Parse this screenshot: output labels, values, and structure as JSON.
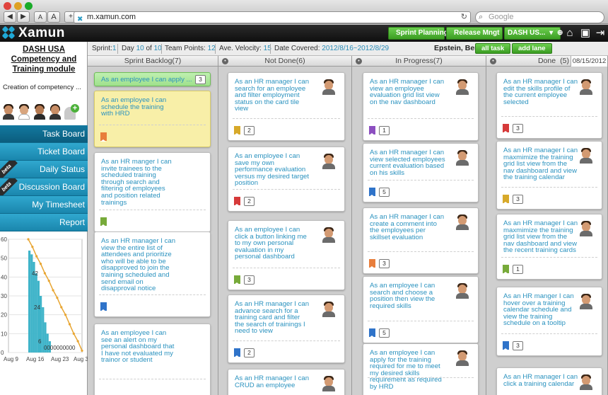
{
  "browser": {
    "back": "◀",
    "forward": "▶",
    "font_smaller": "A",
    "font_larger": "A",
    "add": "+",
    "url": "m.xamun.com",
    "search_placeholder": "Google"
  },
  "header": {
    "logo_text": "Xamun",
    "buttons": [
      "Sprint Planning",
      "Release Mngt",
      "DASH US..."
    ],
    "icons": [
      "home-icon",
      "screen-icon",
      "logout-icon"
    ]
  },
  "sprintbar": {
    "sprint_label": "Sprint:",
    "sprint_value": "1",
    "day_label": "Day",
    "day_value": "10",
    "day_of": "of",
    "day_total": "10",
    "points_label": "Team Points:",
    "points_value": "12",
    "velocity_label": "Ave. Velocity:",
    "velocity_value": "15",
    "date_label": "Date Covered:",
    "date_value": "2012/8/16~2012/8/29",
    "user": "Epstein, Ben",
    "all_task": "all task",
    "add_lane": "add lane"
  },
  "sidebar": {
    "project_title": "DASH USA Competency and Training module",
    "project_desc": "Creation of competency ...",
    "nav": [
      {
        "label": "Task Board",
        "beta": false,
        "active": true
      },
      {
        "label": "Ticket Board",
        "beta": false,
        "active": false
      },
      {
        "label": "Daily Status",
        "beta": true,
        "active": false
      },
      {
        "label": "Discussion Board",
        "beta": true,
        "active": false
      },
      {
        "label": "My Timesheet",
        "beta": false,
        "active": false
      },
      {
        "label": "Report",
        "beta": false,
        "active": false
      }
    ],
    "beta_label": "beta"
  },
  "burndown": {
    "y_ticks": [
      "60",
      "50",
      "40",
      "30",
      "20",
      "10",
      "0"
    ],
    "x_ticks": [
      "Aug 9",
      "Aug 16",
      "Aug 23",
      "Aug 30"
    ],
    "labels": [
      "42",
      "24",
      "6",
      "0000000000"
    ],
    "colors": {
      "bars": "#3fb4c9",
      "ideal": "#e8a531"
    }
  },
  "chart_data": {
    "type": "bar",
    "title": "",
    "xlabel": "",
    "ylabel": "",
    "ylim": [
      0,
      60
    ],
    "x_ticks": [
      "Aug 9",
      "Aug 16",
      "Aug 23",
      "Aug 30"
    ],
    "series": [
      {
        "values": [
          54,
          52,
          48,
          42,
          38,
          30,
          24,
          16,
          10,
          6,
          0,
          0,
          0,
          0,
          0,
          0,
          0,
          0,
          0,
          0
        ]
      },
      {
        "values": [
          60,
          56,
          51,
          47,
          42,
          38,
          33,
          29,
          24,
          20,
          15,
          10,
          6,
          1
        ]
      }
    ],
    "data_labels": [
      "42",
      "24",
      "6",
      "0000000000"
    ]
  },
  "columns": [
    {
      "title": "Sprint Backlog(7)",
      "count": "",
      "date": "",
      "cards": [
        {
          "text": "As an employee I can apply ...",
          "points": "3",
          "style": "green",
          "flag": "",
          "photo": false
        },
        {
          "text": "As an employee I can schedule the training with HRD",
          "points": "",
          "style": "yellow",
          "flag": "#e87e3c",
          "photo": false
        },
        {
          "text": "As an HR manger I can invite trainees to the scheduled training through search and filtering of employees and position related trainings",
          "points": "",
          "style": "",
          "flag": "#77aa3a",
          "photo": false
        },
        {
          "text": "As an HR manager I can view the entire list of attendees and prioritize who will be able to be disapproved to join the training scheduled and send email on disapproval notice",
          "points": "",
          "style": "",
          "flag": "#2f73c9",
          "photo": false
        },
        {
          "text": "As an employee I can see an alert on my personal dashboard that I have not evaluated my trainor or student",
          "points": "",
          "style": "",
          "flag": "",
          "photo": false
        }
      ]
    },
    {
      "title": "Not Done(6)",
      "count": "",
      "date": "",
      "cards": [
        {
          "text": "As an HR manager I can search for an employee and filter employment status on the card tile view",
          "points": "2",
          "flag": "#d7a92a",
          "photo": true
        },
        {
          "text": "As an employee I can save my own performance evaluation versus my desired target position",
          "points": "2",
          "flag": "#d63a3a",
          "photo": true
        },
        {
          "text": "As an employee I can click a button linking me to my own personal evaluation in my personal dashboard",
          "points": "3",
          "flag": "#77aa3a",
          "photo": true
        },
        {
          "text": "As an HR manager I can advance search for a training card and filter the search of trainings I need to view",
          "points": "2",
          "flag": "#2f73c9",
          "photo": true
        },
        {
          "text": "As an HR manager I can CRUD an employee",
          "points": "",
          "flag": "",
          "photo": true
        }
      ]
    },
    {
      "title": "In Progress(7)",
      "count": "",
      "date": "",
      "cards": [
        {
          "text": "As an HR manager I can view an employee evaluation grid list view on the nav dashboard",
          "points": "1",
          "flag": "#8c4fc0",
          "photo": true
        },
        {
          "text": "As an HR manager I can view selected employees current evaluation based on his skills",
          "points": "5",
          "flag": "#2f73c9",
          "photo": true
        },
        {
          "text": "As an HR manager I can create a comment into the employees per skillset evaluation",
          "points": "3",
          "flag": "#e87e3c",
          "photo": true
        },
        {
          "text": "As an employee I can search and choose a position then view the required skills",
          "points": "5",
          "flag": "#2f73c9",
          "photo": true
        },
        {
          "text": "As an employee I can apply for the training required for me to meet my desired skills requirement as required by HRD",
          "points": "",
          "flag": "",
          "photo": true
        }
      ]
    },
    {
      "title": "Done",
      "count": "(5)",
      "date": "08/15/2012",
      "cards": [
        {
          "text": "As an HR manager I can edit the skills profile of the current employee selected",
          "points": "3",
          "flag": "#d63a3a",
          "photo": true
        },
        {
          "text": "As an HR manager I can maxmimize the training grid list view from the nav dashboard and view the training calendar",
          "points": "3",
          "flag": "#d7a92a",
          "photo": true
        },
        {
          "text": "As an HR manager I can maxmimize the training grid list view from the nav dashboard and view the recent training cards",
          "points": "1",
          "flag": "#77aa3a",
          "photo": true
        },
        {
          "text": "As an HR manger I can hover over a training calendar schedule and view the training schedule on a tooltip",
          "points": "3",
          "flag": "#2f73c9",
          "photo": true
        },
        {
          "text": "As an HR manager I can click a training calendar",
          "points": "",
          "flag": "",
          "photo": true
        }
      ]
    }
  ]
}
